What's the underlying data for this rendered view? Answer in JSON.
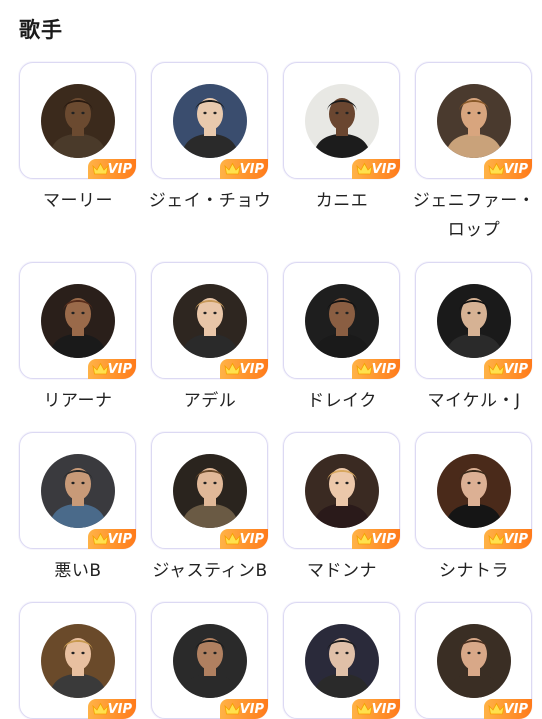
{
  "section": {
    "title": "歌手"
  },
  "badge": {
    "label": "VIP",
    "icon": "crown-icon"
  },
  "colors": {
    "badge_start": "#ffb347",
    "badge_end": "#ff7a1a",
    "card_border": "#dcd9f3"
  },
  "singers": [
    {
      "name": "マーリー",
      "bg": "#3b2a1c",
      "skin": "#6b4a30",
      "hair": "#2a1a10",
      "cloth": "#4a3a2a"
    },
    {
      "name": "ジェイ・チョウ",
      "bg": "#3a4d6e",
      "skin": "#e8c9ad",
      "hair": "#1a1a1a",
      "cloth": "#2a2a2a"
    },
    {
      "name": "カニエ",
      "bg": "#e8e8e4",
      "skin": "#6a4630",
      "hair": "#1a1a1a",
      "cloth": "#1c1c1c"
    },
    {
      "name": "ジェニファー・ロップ",
      "bg": "#4a3a2e",
      "skin": "#d8a57e",
      "hair": "#8a5a2a",
      "cloth": "#c9a27a"
    },
    {
      "name": "リアーナ",
      "bg": "#2a1f1a",
      "skin": "#9a6a4a",
      "hair": "#5a2e1c",
      "cloth": "#1a1a1a"
    },
    {
      "name": "アデル",
      "bg": "#2e2620",
      "skin": "#e9c6a8",
      "hair": "#c89a5a",
      "cloth": "#2a2a2a"
    },
    {
      "name": "ドレイク",
      "bg": "#1e1e1e",
      "skin": "#8a5e42",
      "hair": "#111111",
      "cloth": "#1a1a1a"
    },
    {
      "name": "マイケル・J",
      "bg": "#1a1a1a",
      "skin": "#d6b294",
      "hair": "#111111",
      "cloth": "#2a2a2a"
    },
    {
      "name": "悪いB",
      "bg": "#3a3a3e",
      "skin": "#c89a78",
      "hair": "#2a2a2a",
      "cloth": "#4a6a8a"
    },
    {
      "name": "ジャスティンB",
      "bg": "#2a241e",
      "skin": "#e0b898",
      "hair": "#6a4a2a",
      "cloth": "#6a5a44"
    },
    {
      "name": "マドンナ",
      "bg": "#3a2a22",
      "skin": "#ecc8aa",
      "hair": "#d8a860",
      "cloth": "#2a1a1a"
    },
    {
      "name": "シナトラ",
      "bg": "#4a2a1a",
      "skin": "#dcb094",
      "hair": "#3a2a1a",
      "cloth": "#151515"
    },
    {
      "name": "",
      "bg": "#6a4a2a",
      "skin": "#e8c0a0",
      "hair": "#c89a50",
      "cloth": "#3a3a3a"
    },
    {
      "name": "",
      "bg": "#2a2a2a",
      "skin": "#b08060",
      "hair": "#1a1a1a",
      "cloth": "#2a2a2a"
    },
    {
      "name": "",
      "bg": "#2a2a3a",
      "skin": "#e0c0a8",
      "hair": "#1a1a1a",
      "cloth": "#2a2a2a"
    },
    {
      "name": "",
      "bg": "#3a2e24",
      "skin": "#d8a888",
      "hair": "#4a3020",
      "cloth": "#3a2e24"
    }
  ]
}
